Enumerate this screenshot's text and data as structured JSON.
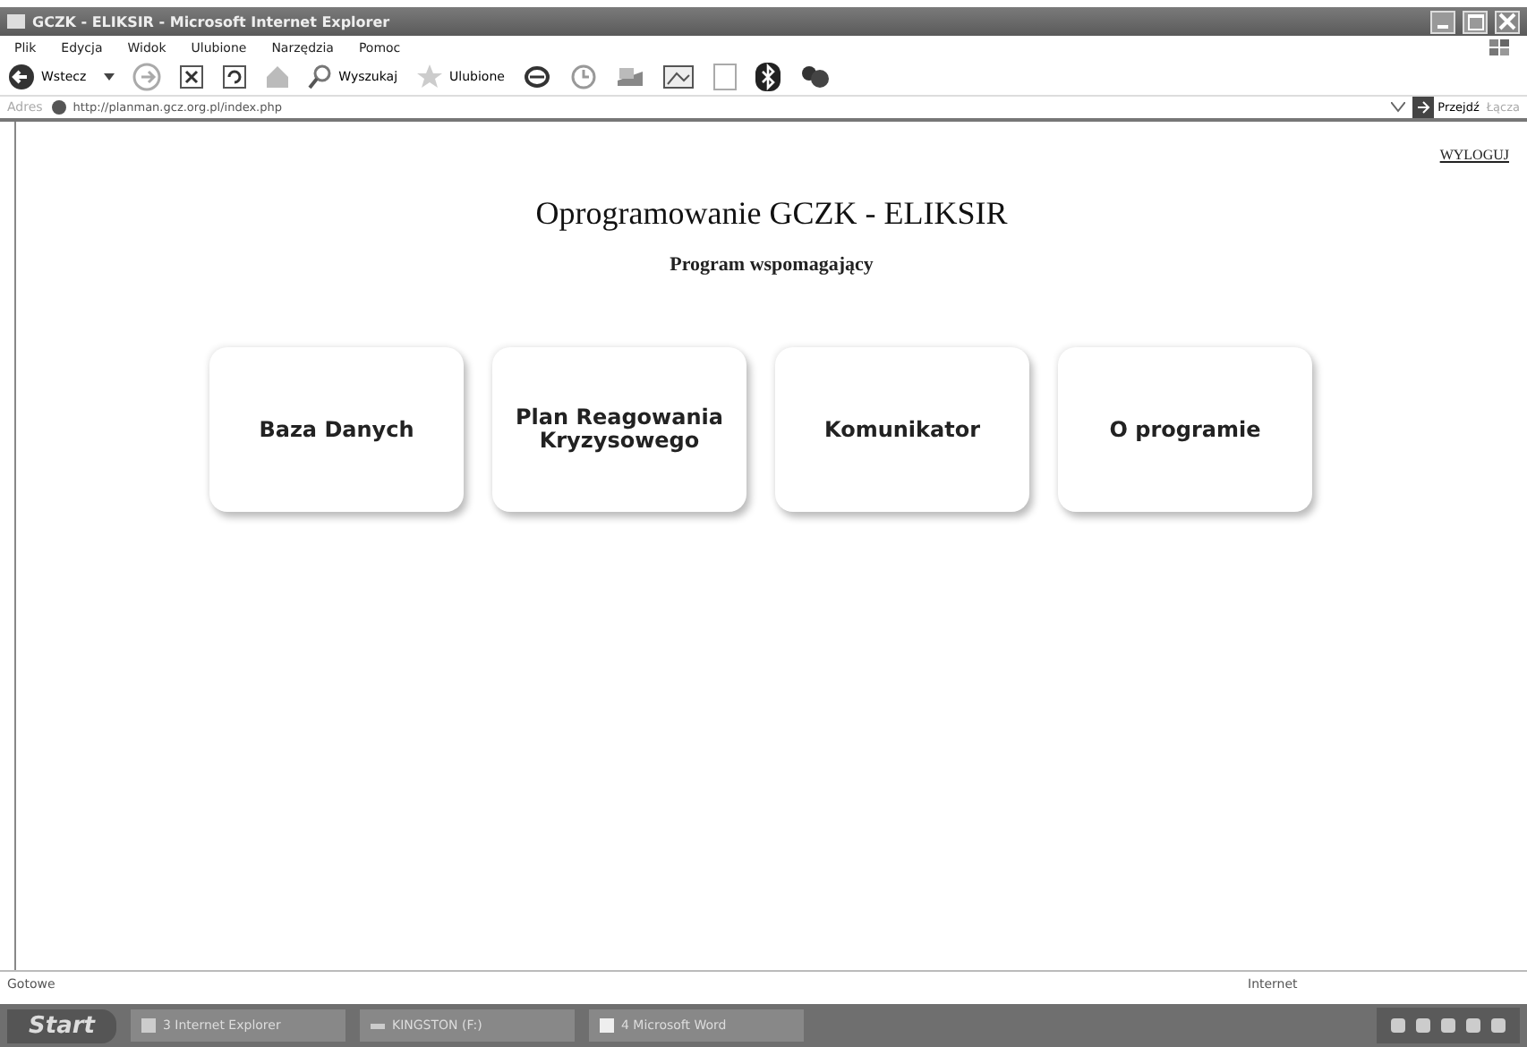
{
  "window": {
    "title": "GCZK - ELIKSIR - Microsoft Internet Explorer"
  },
  "menu": [
    "Plik",
    "Edycja",
    "Widok",
    "Ulubione",
    "Narzędzia",
    "Pomoc"
  ],
  "toolbar": {
    "back": "Wstecz",
    "search": "Wyszukaj",
    "favorites": "Ulubione"
  },
  "address_bar": {
    "label": "Adres",
    "url": "http://planman.gcz.org.pl/index.php",
    "go": "Przejdź",
    "links": "Łącza"
  },
  "page": {
    "logout": "WYLOGUJ",
    "title": "Oprogramowanie GCZK - ELIKSIR",
    "subtitle": "Program wspomagający",
    "tiles": [
      {
        "label": "Baza Danych"
      },
      {
        "label": "Plan Reagowania Kryzysowego"
      },
      {
        "label": "Komunikator"
      },
      {
        "label": "O programie"
      }
    ]
  },
  "status_bar": {
    "status": "Gotowe",
    "zone": "Internet"
  },
  "taskbar": {
    "start": "Start",
    "tasks": [
      {
        "label": "3 Internet Explorer",
        "kind": "ie"
      },
      {
        "label": "KINGSTON (F:)",
        "kind": "drive"
      },
      {
        "label": "4 Microsoft Word",
        "kind": "word"
      }
    ]
  }
}
